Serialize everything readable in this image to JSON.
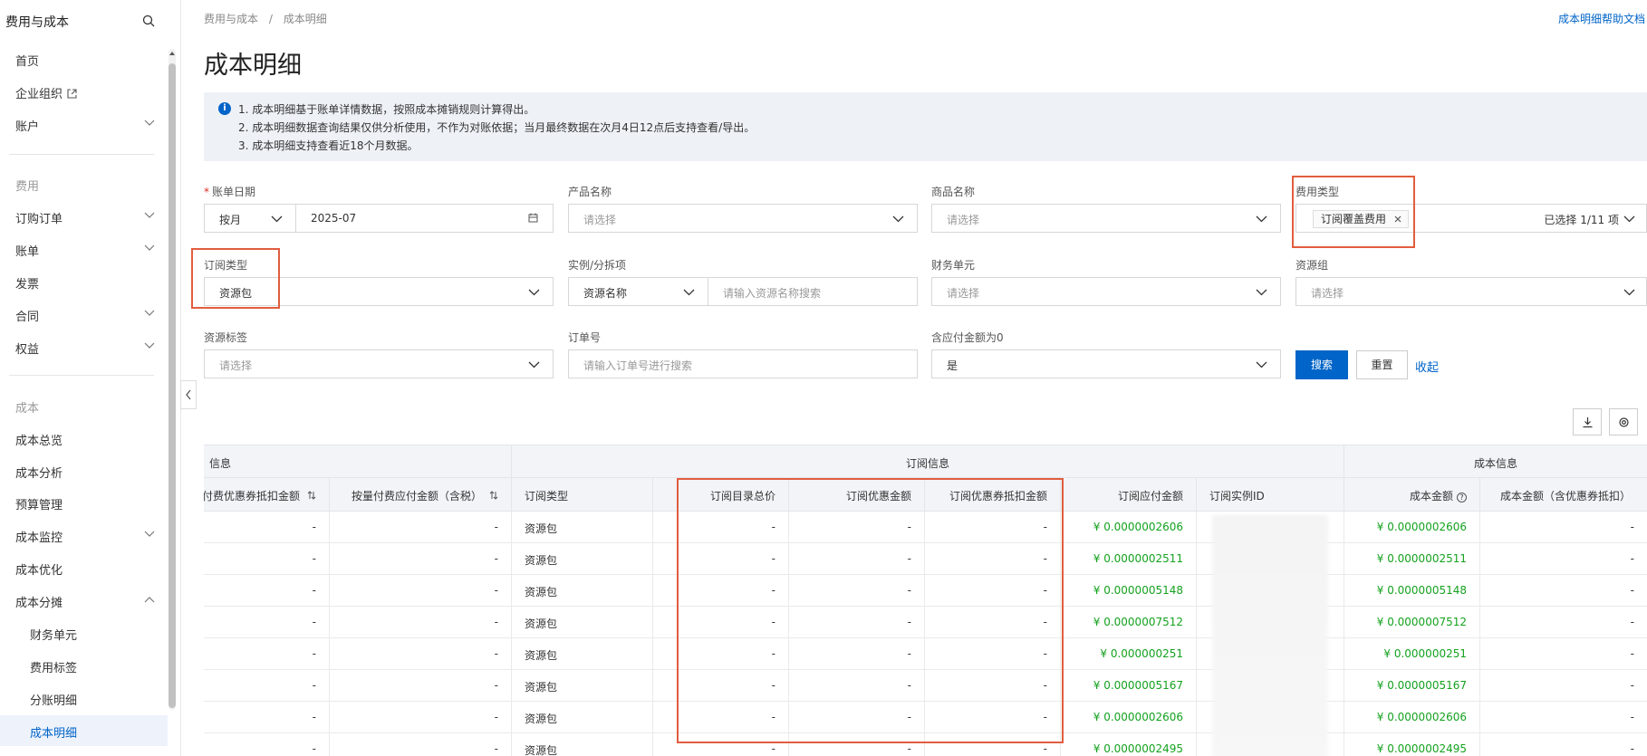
{
  "sidebar": {
    "title": "费用与成本",
    "items": [
      {
        "label": "首页"
      },
      {
        "label": "企业组织"
      },
      {
        "label": "账户"
      },
      {
        "label": "订购订单"
      },
      {
        "label": "账单"
      },
      {
        "label": "发票"
      },
      {
        "label": "合同"
      },
      {
        "label": "权益"
      },
      {
        "label": "成本总览"
      },
      {
        "label": "成本分析"
      },
      {
        "label": "预算管理"
      },
      {
        "label": "成本监控"
      },
      {
        "label": "成本优化"
      },
      {
        "label": "成本分摊"
      },
      {
        "label": "财务单元"
      },
      {
        "label": "费用标签"
      },
      {
        "label": "分账明细"
      },
      {
        "label": "成本明细"
      }
    ],
    "groups": {
      "fee": "费用",
      "cost": "成本"
    }
  },
  "breadcrumb": {
    "parent": "费用与成本",
    "sep": "/",
    "current": "成本明细"
  },
  "help_link": "成本明细帮助文档",
  "page_title": "成本明细",
  "notice": {
    "lines": [
      "1. 成本明细基于账单详情数据，按照成本摊销规则计算得出。",
      "2. 成本明细数据查询结果仅供分析使用，不作为对账依据；当月最终数据在次月4日12点后支持查看/导出。",
      "3. 成本明细支持查看近18个月数据。"
    ]
  },
  "filters": {
    "bill_date": {
      "label": "账单日期",
      "granularity": "按月",
      "value": "2025-07"
    },
    "product_name": {
      "label": "产品名称",
      "placeholder": "请选择"
    },
    "commodity_name": {
      "label": "商品名称",
      "placeholder": "请选择"
    },
    "fee_type": {
      "label": "费用类型",
      "tag": "订阅覆盖费用",
      "count": "已选择 1/11 项"
    },
    "subscription_type": {
      "label": "订阅类型",
      "value": "资源包"
    },
    "instance": {
      "label": "实例/分拆项",
      "field": "资源名称",
      "placeholder": "请输入资源名称搜索"
    },
    "finance_unit": {
      "label": "财务单元",
      "placeholder": "请选择"
    },
    "resource_group": {
      "label": "资源组",
      "placeholder": "请选择"
    },
    "resource_tag": {
      "label": "资源标签",
      "placeholder": "请选择"
    },
    "order_no": {
      "label": "订单号",
      "placeholder": "请输入订单号进行搜索"
    },
    "zero_amount": {
      "label": "含应付金额为0",
      "value": "是"
    },
    "search_btn": "搜索",
    "reset_btn": "重置",
    "collapse_link": "收起"
  },
  "table": {
    "groups": {
      "left": "信息",
      "subscription": "订阅信息",
      "cost": "成本信息"
    },
    "columns": {
      "c1": "付费优惠券抵扣金额",
      "c2": "按量付费应付金额（含税）",
      "c3": "订阅类型",
      "c4": "订阅目录总价",
      "c5": "订阅优惠金额",
      "c6": "订阅优惠券抵扣金额",
      "c7": "订阅应付金额",
      "c8": "订阅实例ID",
      "c9": "成本金额",
      "c10": "成本金额（含优惠券抵扣）"
    },
    "rows": [
      {
        "c1": "-",
        "c2": "-",
        "c3": "资源包",
        "c4": "-",
        "c5": "-",
        "c6": "-",
        "c7": "¥ 0.0000002606",
        "c9": "¥ 0.0000002606",
        "c10": "-"
      },
      {
        "c1": "-",
        "c2": "-",
        "c3": "资源包",
        "c4": "-",
        "c5": "-",
        "c6": "-",
        "c7": "¥ 0.0000002511",
        "c9": "¥ 0.0000002511",
        "c10": "-"
      },
      {
        "c1": "-",
        "c2": "-",
        "c3": "资源包",
        "c4": "-",
        "c5": "-",
        "c6": "-",
        "c7": "¥ 0.0000005148",
        "c9": "¥ 0.0000005148",
        "c10": "-"
      },
      {
        "c1": "-",
        "c2": "-",
        "c3": "资源包",
        "c4": "-",
        "c5": "-",
        "c6": "-",
        "c7": "¥ 0.0000007512",
        "c9": "¥ 0.0000007512",
        "c10": "-"
      },
      {
        "c1": "-",
        "c2": "-",
        "c3": "资源包",
        "c4": "-",
        "c5": "-",
        "c6": "-",
        "c7": "¥ 0.000000251",
        "c9": "¥ 0.000000251",
        "c10": "-"
      },
      {
        "c1": "-",
        "c2": "-",
        "c3": "资源包",
        "c4": "-",
        "c5": "-",
        "c6": "-",
        "c7": "¥ 0.0000005167",
        "c9": "¥ 0.0000005167",
        "c10": "-"
      },
      {
        "c1": "-",
        "c2": "-",
        "c3": "资源包",
        "c4": "-",
        "c5": "-",
        "c6": "-",
        "c7": "¥ 0.0000002606",
        "c9": "¥ 0.0000002606",
        "c10": "-"
      },
      {
        "c1": "-",
        "c2": "-",
        "c3": "资源包",
        "c4": "-",
        "c5": "-",
        "c6": "-",
        "c7": "¥ 0.0000002495",
        "c9": "¥ 0.0000002495",
        "c10": "-"
      }
    ]
  },
  "colors": {
    "accent": "#0064c8",
    "money": "#14a21e",
    "highlight": "#e15d3f"
  },
  "icons": [
    "search-icon",
    "external-link-icon",
    "chevron-down-icon",
    "chevron-up-icon",
    "calendar-icon",
    "close-icon",
    "info-icon",
    "download-icon",
    "settings-icon",
    "sort-icon",
    "help-icon",
    "collapse-arrow-icon"
  ]
}
